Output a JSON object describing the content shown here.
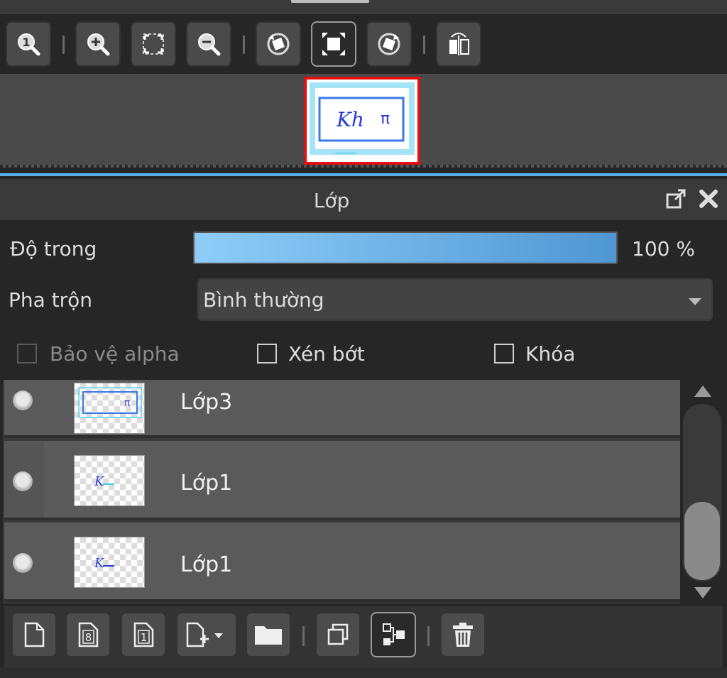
{
  "navigator": {
    "toolbar_icons": [
      "zoom-actual-icon",
      "zoom-in-icon",
      "fit-screen-icon",
      "zoom-out-icon",
      "rotate-left-icon",
      "fit-canvas-icon",
      "rotate-right-icon",
      "flip-icon"
    ]
  },
  "layers_panel": {
    "title": "Lớp",
    "opacity_label": "Độ trong",
    "opacity_value": "100 %",
    "opacity_percent": 100,
    "blend_label": "Pha trộn",
    "blend_value": "Bình thường",
    "checkboxes": {
      "protect_alpha": "Bảo vệ alpha",
      "clipping": "Xén bớt",
      "lock": "Khóa"
    },
    "layers": [
      {
        "name": "Lớp3"
      },
      {
        "name": "Lớp1"
      },
      {
        "name": "Lớp1"
      }
    ],
    "bottom_icons": [
      "new-layer-icon",
      "new-8bit-layer-icon",
      "new-1bit-layer-icon",
      "add-layer-menu-icon",
      "new-folder-icon",
      "duplicate-layer-icon",
      "merge-down-icon",
      "delete-layer-icon"
    ]
  },
  "colors": {
    "accent": "#5aaee8",
    "preview_border": "#e01010",
    "opacity_fill_start": "#8ecdf8",
    "opacity_fill_end": "#4f97d4"
  }
}
